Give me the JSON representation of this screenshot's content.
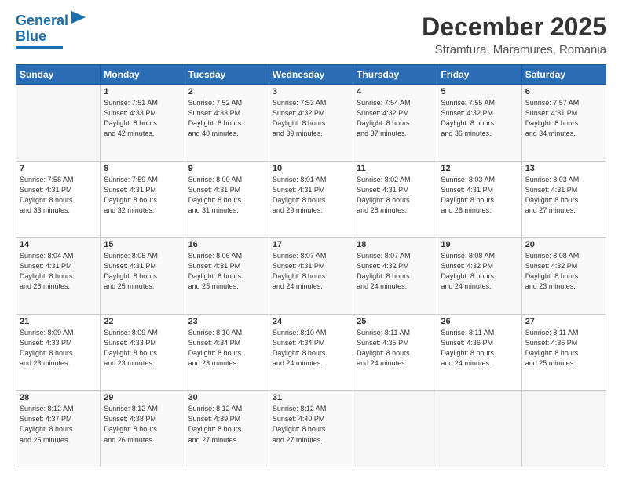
{
  "header": {
    "logo_line1": "General",
    "logo_line2": "Blue",
    "main_title": "December 2025",
    "subtitle": "Stramtura, Maramures, Romania"
  },
  "days_of_week": [
    "Sunday",
    "Monday",
    "Tuesday",
    "Wednesday",
    "Thursday",
    "Friday",
    "Saturday"
  ],
  "weeks": [
    [
      {
        "num": "",
        "lines": []
      },
      {
        "num": "1",
        "lines": [
          "Sunrise: 7:51 AM",
          "Sunset: 4:33 PM",
          "Daylight: 8 hours",
          "and 42 minutes."
        ]
      },
      {
        "num": "2",
        "lines": [
          "Sunrise: 7:52 AM",
          "Sunset: 4:33 PM",
          "Daylight: 8 hours",
          "and 40 minutes."
        ]
      },
      {
        "num": "3",
        "lines": [
          "Sunrise: 7:53 AM",
          "Sunset: 4:32 PM",
          "Daylight: 8 hours",
          "and 39 minutes."
        ]
      },
      {
        "num": "4",
        "lines": [
          "Sunrise: 7:54 AM",
          "Sunset: 4:32 PM",
          "Daylight: 8 hours",
          "and 37 minutes."
        ]
      },
      {
        "num": "5",
        "lines": [
          "Sunrise: 7:55 AM",
          "Sunset: 4:32 PM",
          "Daylight: 8 hours",
          "and 36 minutes."
        ]
      },
      {
        "num": "6",
        "lines": [
          "Sunrise: 7:57 AM",
          "Sunset: 4:31 PM",
          "Daylight: 8 hours",
          "and 34 minutes."
        ]
      }
    ],
    [
      {
        "num": "7",
        "lines": [
          "Sunrise: 7:58 AM",
          "Sunset: 4:31 PM",
          "Daylight: 8 hours",
          "and 33 minutes."
        ]
      },
      {
        "num": "8",
        "lines": [
          "Sunrise: 7:59 AM",
          "Sunset: 4:31 PM",
          "Daylight: 8 hours",
          "and 32 minutes."
        ]
      },
      {
        "num": "9",
        "lines": [
          "Sunrise: 8:00 AM",
          "Sunset: 4:31 PM",
          "Daylight: 8 hours",
          "and 31 minutes."
        ]
      },
      {
        "num": "10",
        "lines": [
          "Sunrise: 8:01 AM",
          "Sunset: 4:31 PM",
          "Daylight: 8 hours",
          "and 29 minutes."
        ]
      },
      {
        "num": "11",
        "lines": [
          "Sunrise: 8:02 AM",
          "Sunset: 4:31 PM",
          "Daylight: 8 hours",
          "and 28 minutes."
        ]
      },
      {
        "num": "12",
        "lines": [
          "Sunrise: 8:03 AM",
          "Sunset: 4:31 PM",
          "Daylight: 8 hours",
          "and 28 minutes."
        ]
      },
      {
        "num": "13",
        "lines": [
          "Sunrise: 8:03 AM",
          "Sunset: 4:31 PM",
          "Daylight: 8 hours",
          "and 27 minutes."
        ]
      }
    ],
    [
      {
        "num": "14",
        "lines": [
          "Sunrise: 8:04 AM",
          "Sunset: 4:31 PM",
          "Daylight: 8 hours",
          "and 26 minutes."
        ]
      },
      {
        "num": "15",
        "lines": [
          "Sunrise: 8:05 AM",
          "Sunset: 4:31 PM",
          "Daylight: 8 hours",
          "and 25 minutes."
        ]
      },
      {
        "num": "16",
        "lines": [
          "Sunrise: 8:06 AM",
          "Sunset: 4:31 PM",
          "Daylight: 8 hours",
          "and 25 minutes."
        ]
      },
      {
        "num": "17",
        "lines": [
          "Sunrise: 8:07 AM",
          "Sunset: 4:31 PM",
          "Daylight: 8 hours",
          "and 24 minutes."
        ]
      },
      {
        "num": "18",
        "lines": [
          "Sunrise: 8:07 AM",
          "Sunset: 4:32 PM",
          "Daylight: 8 hours",
          "and 24 minutes."
        ]
      },
      {
        "num": "19",
        "lines": [
          "Sunrise: 8:08 AM",
          "Sunset: 4:32 PM",
          "Daylight: 8 hours",
          "and 24 minutes."
        ]
      },
      {
        "num": "20",
        "lines": [
          "Sunrise: 8:08 AM",
          "Sunset: 4:32 PM",
          "Daylight: 8 hours",
          "and 23 minutes."
        ]
      }
    ],
    [
      {
        "num": "21",
        "lines": [
          "Sunrise: 8:09 AM",
          "Sunset: 4:33 PM",
          "Daylight: 8 hours",
          "and 23 minutes."
        ]
      },
      {
        "num": "22",
        "lines": [
          "Sunrise: 8:09 AM",
          "Sunset: 4:33 PM",
          "Daylight: 8 hours",
          "and 23 minutes."
        ]
      },
      {
        "num": "23",
        "lines": [
          "Sunrise: 8:10 AM",
          "Sunset: 4:34 PM",
          "Daylight: 8 hours",
          "and 23 minutes."
        ]
      },
      {
        "num": "24",
        "lines": [
          "Sunrise: 8:10 AM",
          "Sunset: 4:34 PM",
          "Daylight: 8 hours",
          "and 24 minutes."
        ]
      },
      {
        "num": "25",
        "lines": [
          "Sunrise: 8:11 AM",
          "Sunset: 4:35 PM",
          "Daylight: 8 hours",
          "and 24 minutes."
        ]
      },
      {
        "num": "26",
        "lines": [
          "Sunrise: 8:11 AM",
          "Sunset: 4:36 PM",
          "Daylight: 8 hours",
          "and 24 minutes."
        ]
      },
      {
        "num": "27",
        "lines": [
          "Sunrise: 8:11 AM",
          "Sunset: 4:36 PM",
          "Daylight: 8 hours",
          "and 25 minutes."
        ]
      }
    ],
    [
      {
        "num": "28",
        "lines": [
          "Sunrise: 8:12 AM",
          "Sunset: 4:37 PM",
          "Daylight: 8 hours",
          "and 25 minutes."
        ]
      },
      {
        "num": "29",
        "lines": [
          "Sunrise: 8:12 AM",
          "Sunset: 4:38 PM",
          "Daylight: 8 hours",
          "and 26 minutes."
        ]
      },
      {
        "num": "30",
        "lines": [
          "Sunrise: 8:12 AM",
          "Sunset: 4:39 PM",
          "Daylight: 8 hours",
          "and 27 minutes."
        ]
      },
      {
        "num": "31",
        "lines": [
          "Sunrise: 8:12 AM",
          "Sunset: 4:40 PM",
          "Daylight: 8 hours",
          "and 27 minutes."
        ]
      },
      {
        "num": "",
        "lines": []
      },
      {
        "num": "",
        "lines": []
      },
      {
        "num": "",
        "lines": []
      }
    ]
  ]
}
